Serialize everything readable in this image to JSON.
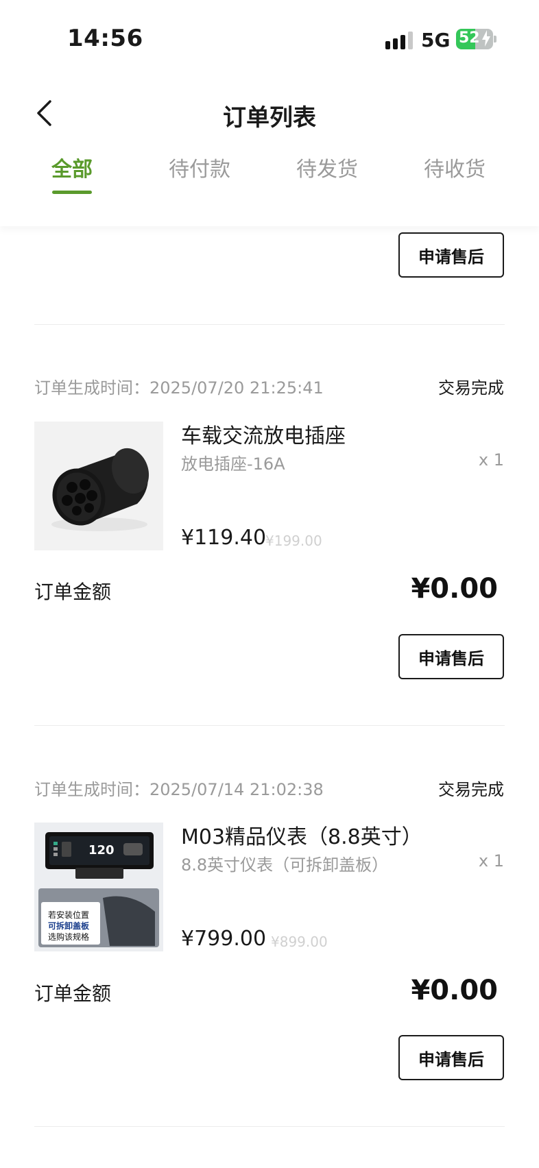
{
  "status_bar": {
    "time": "14:56",
    "network": "5G",
    "battery_level": "52",
    "battery_percent": 52
  },
  "header": {
    "title": "订单列表"
  },
  "tabs": [
    {
      "label": "全部",
      "active": true
    },
    {
      "label": "待付款",
      "active": false
    },
    {
      "label": "待发货",
      "active": false
    },
    {
      "label": "待收货",
      "active": false
    }
  ],
  "partial_order": {
    "aftersale_label": "申请售后"
  },
  "orders": [
    {
      "time_label": "订单生成时间：2025/07/20 21:25:41",
      "status": "交易完成",
      "product_name": "车载交流放电插座",
      "spec": "放电插座-16A",
      "qty": "x 1",
      "price": "¥119.40",
      "original_price": "¥199.00",
      "amount_label": "订单金额",
      "amount": "¥0.00",
      "aftersale_label": "申请售后"
    },
    {
      "time_label": "订单生成时间：2025/07/14 21:02:38",
      "status": "交易完成",
      "product_name": "M03精品仪表（8.8英寸）",
      "spec": "8.8英寸仪表（可拆卸盖板）",
      "qty": "x 1",
      "price": "¥799.00",
      "original_price": "¥899.00",
      "amount_label": "订单金额",
      "amount": "¥0.00",
      "aftersale_label": "申请售后",
      "image_text": {
        "speed": "120",
        "line1": "若安装位置",
        "line2": "可拆卸盖板",
        "line3": "选购该规格"
      }
    }
  ],
  "colors": {
    "accent": "#5a9a2c",
    "battery": "#34c759"
  }
}
